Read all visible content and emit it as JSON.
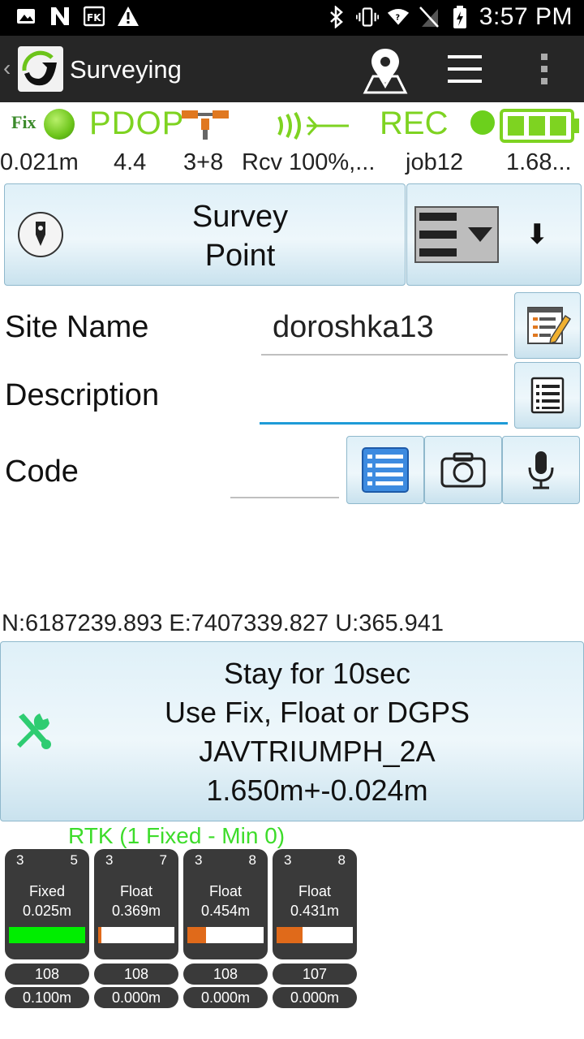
{
  "statusbar": {
    "time": "3:57 PM"
  },
  "appbar": {
    "title": "Surveying"
  },
  "status_icons": {
    "fix": "Fix",
    "pdop": "PDOP",
    "rec": "REC"
  },
  "info_row": {
    "accuracy": "0.021m",
    "pdop_value": "4.4",
    "satellites": "3+8",
    "receiver": "Rcv 100%,...",
    "job": "job12",
    "height": "1.68..."
  },
  "survey_button": {
    "line1": "Survey",
    "line2": "Point"
  },
  "fields": {
    "site_name_label": "Site Name",
    "site_name_value": "doroshka13",
    "description_label": "Description",
    "description_value": "",
    "code_label": "Code",
    "code_value": ""
  },
  "coords": "N:6187239.893  E:7407339.827  U:365.941",
  "stay_button": {
    "line1": "Stay for 10sec",
    "line2": "Use Fix, Float or DGPS",
    "line3": "JAVTRIUMPH_2A",
    "line4": "1.650m+-0.024m"
  },
  "rtk": {
    "title": "RTK (1 Fixed - Min 0)",
    "tiles": [
      {
        "left": "3",
        "right": "5",
        "state": "Fixed",
        "value": "0.025m",
        "fill_fraction": 1.0,
        "fill_color": "#00ee00",
        "count": "108",
        "distance": "0.100m"
      },
      {
        "left": "3",
        "right": "7",
        "state": "Float",
        "value": "0.369m",
        "fill_fraction": 0.04,
        "fill_color": "#e06a1a",
        "count": "108",
        "distance": "0.000m"
      },
      {
        "left": "3",
        "right": "8",
        "state": "Float",
        "value": "0.454m",
        "fill_fraction": 0.24,
        "fill_color": "#e06a1a",
        "count": "108",
        "distance": "0.000m"
      },
      {
        "left": "3",
        "right": "8",
        "state": "Float",
        "value": "0.431m",
        "fill_fraction": 0.34,
        "fill_color": "#e06a1a",
        "count": "107",
        "distance": "0.000m"
      }
    ]
  }
}
